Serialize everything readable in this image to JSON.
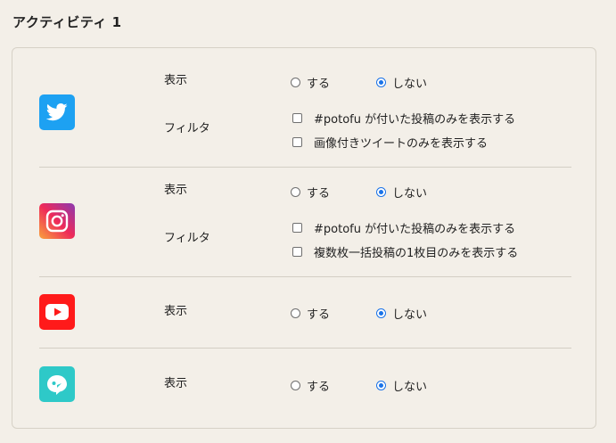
{
  "page": {
    "title": "アクティビティ 1"
  },
  "labels": {
    "display": "表示",
    "filter": "フィルタ",
    "show": "する",
    "hide": "しない"
  },
  "sections": [
    {
      "service": "twitter",
      "icon": "twitter-bird-icon",
      "color": "#1da1f2",
      "display_selected": "しない",
      "filters": [
        {
          "label": "#potofu が付いた投稿のみを表示する",
          "checked": false
        },
        {
          "label": "画像付きツイートのみを表示する",
          "checked": false
        }
      ]
    },
    {
      "service": "instagram",
      "icon": "instagram-camera-icon",
      "color": "#d6297b",
      "display_selected": "しない",
      "filters": [
        {
          "label": "#potofu が付いた投稿のみを表示する",
          "checked": false
        },
        {
          "label": "複数枚一括投稿の1枚目のみを表示する",
          "checked": false
        }
      ]
    },
    {
      "service": "youtube",
      "icon": "youtube-play-icon",
      "color": "#ff0000",
      "display_selected": "しない",
      "filters": []
    },
    {
      "service": "potofu",
      "icon": "potofu-bird-icon",
      "color": "#2ec9c8",
      "display_selected": "しない",
      "filters": []
    }
  ]
}
